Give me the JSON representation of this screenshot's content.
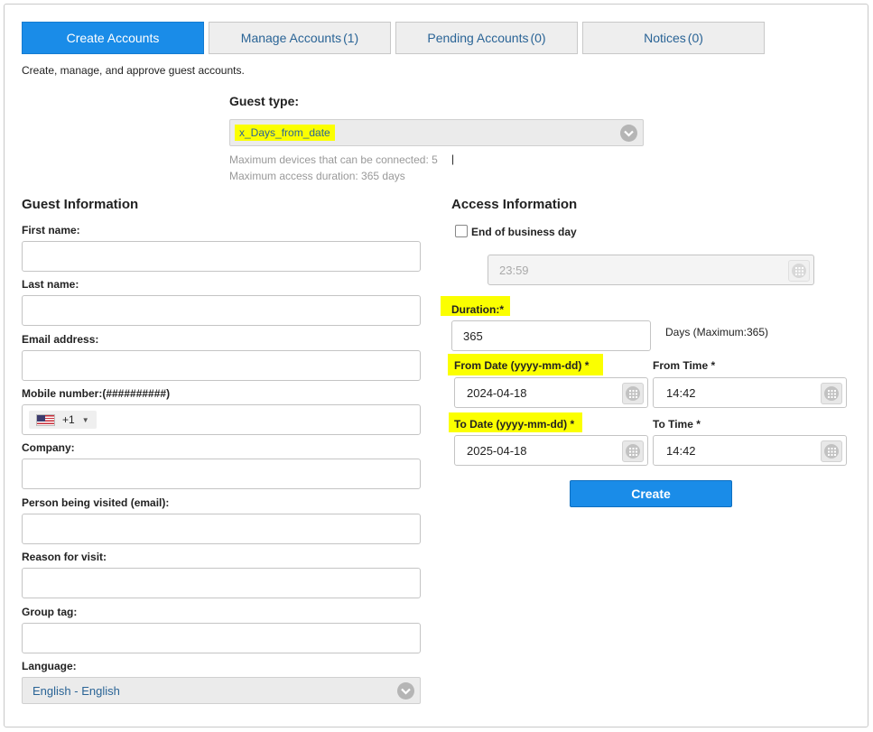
{
  "tabs": [
    {
      "label": "Create Accounts",
      "count": ""
    },
    {
      "label": "Manage Accounts",
      "count": "(1)"
    },
    {
      "label": "Pending Accounts",
      "count": "(0)"
    },
    {
      "label": "Notices",
      "count": "(0)"
    }
  ],
  "subtitle": "Create, manage, and approve guest accounts.",
  "guest_type": {
    "label": "Guest type:",
    "selected": "x_Days_from_date",
    "max_devices": "Maximum devices that can be connected: 5",
    "max_duration": "Maximum access duration: 365 days",
    "cursor": "|"
  },
  "guest_info": {
    "title": "Guest Information",
    "first_name_label": "First name:",
    "last_name_label": "Last name:",
    "email_label": "Email address:",
    "mobile_label": "Mobile number:(##########)",
    "country_code": "+1",
    "company_label": "Company:",
    "person_visited_label": "Person being visited (email):",
    "reason_label": "Reason for visit:",
    "group_tag_label": "Group tag:",
    "language_label": "Language:",
    "language_selected": "English - English"
  },
  "access_info": {
    "title": "Access Information",
    "end_of_day_label": "End of business day",
    "end_of_day_checked": false,
    "end_time_value": "23:59",
    "duration_label": "Duration:*",
    "duration_value": "365",
    "duration_hint": "Days (Maximum:365)",
    "from_date_label": "From Date (yyyy-mm-dd) *",
    "from_date_value": "2024-04-18",
    "from_time_label": "From Time *",
    "from_time_value": "14:42",
    "to_date_label": "To Date (yyyy-mm-dd) *",
    "to_date_value": "2025-04-18",
    "to_time_label": "To Time *",
    "to_time_value": "14:42",
    "create_label": "Create"
  },
  "colors": {
    "accent": "#1a8ce8",
    "highlight": "#fbff00",
    "link": "#2a6496"
  }
}
